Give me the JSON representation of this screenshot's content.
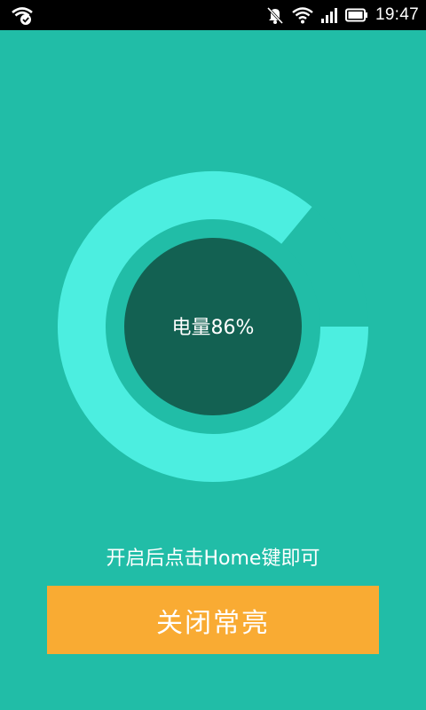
{
  "status_bar": {
    "time": "19:47",
    "icons": [
      "wifi-check-icon",
      "mute-bell-icon",
      "wifi-icon",
      "signal-icon",
      "battery-icon"
    ]
  },
  "battery": {
    "label": "电量86%",
    "level": 0.86
  },
  "hint": "开启后点击Home键即可",
  "button": {
    "label": "关闭常亮"
  },
  "colors": {
    "background": "#21bda7",
    "ring": "#4ceee0",
    "center": "#136152",
    "button": "#f9ab33",
    "text": "#ffffff"
  }
}
